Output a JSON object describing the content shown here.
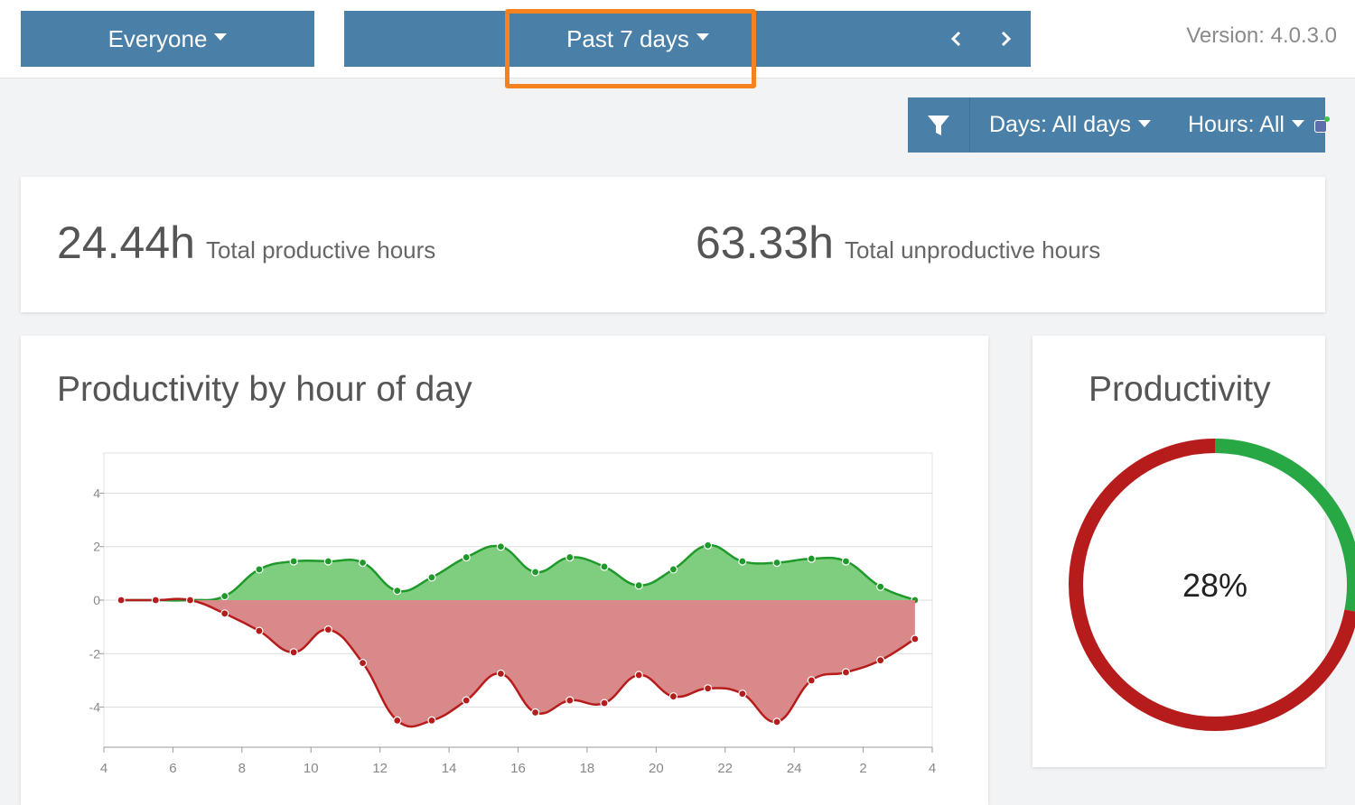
{
  "header": {
    "audience_label": "Everyone",
    "period_label": "Past 7 days",
    "version_text": "Version: 4.0.3.0"
  },
  "filters": {
    "days_label": "Days: All days",
    "hours_label": "Hours: All"
  },
  "summary": {
    "productive_value": "24.44h",
    "productive_label": "Total productive hours",
    "unproductive_value": "63.33h",
    "unproductive_label": "Total unproductive hours"
  },
  "colors": {
    "accent": "#4a80a8",
    "highlight": "#f5821f",
    "productive": "#1f9a2a",
    "productive_fill": "#7fcd7f",
    "unproductive": "#b71c1c",
    "unproductive_fill": "#d98989"
  },
  "chart_data": [
    {
      "type": "area",
      "title": "Productivity by hour of day",
      "xlabel": "",
      "ylabel": "",
      "x": [
        4.5,
        5.5,
        6.5,
        7.5,
        8.5,
        9.5,
        10.5,
        11.5,
        12.5,
        13.5,
        14.5,
        15.5,
        16.5,
        17.5,
        18.5,
        19.5,
        20.5,
        21.5,
        22.5,
        23.5,
        24.5,
        25.5,
        26.5,
        27.5
      ],
      "xticks": [
        4,
        6,
        8,
        10,
        12,
        14,
        16,
        18,
        20,
        22,
        24,
        26,
        28
      ],
      "xtick_labels": [
        "4",
        "6",
        "8",
        "10",
        "12",
        "14",
        "16",
        "18",
        "20",
        "22",
        "24",
        "2",
        "4"
      ],
      "yticks": [
        -4,
        -2,
        0,
        2,
        4
      ],
      "xlim": [
        4,
        28
      ],
      "ylim": [
        -5.5,
        5.5
      ],
      "grid": true,
      "series": [
        {
          "color": "#1f9a2a",
          "fill": "#7fcd7f",
          "values": [
            0,
            0,
            0,
            0.15,
            1.15,
            1.45,
            1.45,
            1.4,
            0.35,
            0.85,
            1.6,
            2.0,
            1.05,
            1.6,
            1.25,
            0.55,
            1.15,
            2.05,
            1.45,
            1.4,
            1.55,
            1.45,
            0.5,
            0
          ]
        },
        {
          "color": "#b71c1c",
          "fill": "#d98989",
          "values": [
            0,
            0,
            0,
            -0.5,
            -1.15,
            -1.95,
            -1.1,
            -2.35,
            -4.5,
            -4.5,
            -3.75,
            -2.75,
            -4.2,
            -3.75,
            -3.85,
            -2.8,
            -3.6,
            -3.3,
            -3.5,
            -4.55,
            -3.0,
            -2.7,
            -2.25,
            -1.45
          ]
        }
      ]
    },
    {
      "type": "pie",
      "title": "Productivity",
      "center_label": "28%",
      "values": [
        28,
        72
      ],
      "colors": [
        "#27a844",
        "#b71c1c"
      ]
    }
  ]
}
